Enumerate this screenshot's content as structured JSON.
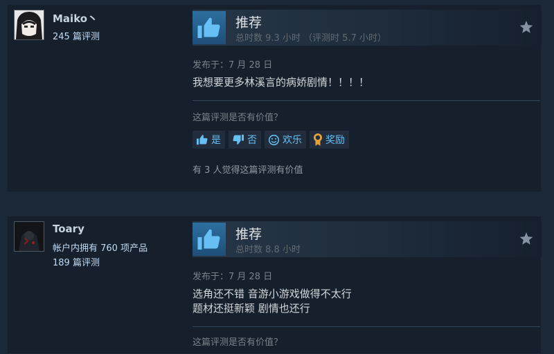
{
  "reviews": [
    {
      "user": {
        "name": "Maiko丶",
        "review_count": "245 篇评测"
      },
      "verdict": "推荐",
      "hours": "总时数 9.3 小时 （评测时 5.7 小时）",
      "posted": "发布于：7 月 28 日",
      "text": [
        "我想要更多林溪言的病娇剧情！！！！"
      ],
      "helpful_question": "这篇评测是否有价值？",
      "buttons": {
        "yes": "是",
        "no": "否",
        "funny": "欢乐",
        "award": "奖励"
      },
      "found_helpful": "有 3 人觉得这篇评测有价值"
    },
    {
      "user": {
        "name": "Toary",
        "products": "帐户内拥有 760 项产品",
        "review_count": "189 篇评测"
      },
      "verdict": "推荐",
      "hours": "总时数 8.8 小时",
      "posted": "发布于：7 月 28 日",
      "text": [
        "选角还不错 音游小游戏做得不太行",
        "题材还挺新颖 剧情也还行"
      ],
      "helpful_question": "这篇评测是否有价值？"
    }
  ],
  "icons": {
    "thumb": "thumbs-up-icon",
    "star": "star-icon",
    "yes": "thumbs-up-icon",
    "no": "thumbs-down-icon",
    "funny": "smiley-icon",
    "award": "award-icon"
  },
  "colors": {
    "background": "#1b2838",
    "card": "#16202d",
    "accent": "#66c0f4",
    "thumb_bg": "#2d6f9f",
    "award": "#e3a33a"
  }
}
